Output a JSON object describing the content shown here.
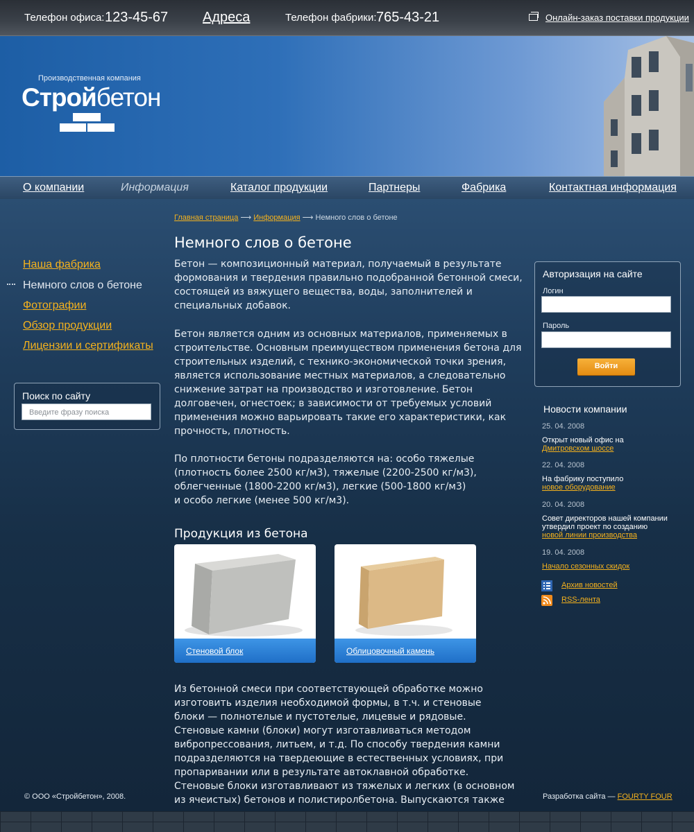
{
  "topbar": {
    "office_label": "Телефон офиса:",
    "office_phone": "123-45-67",
    "addresses": "Адреса",
    "factory_label": "Телефон фабрики:",
    "factory_phone": "765-43-21",
    "order_link": "Онлайн-заказ поставки продукции"
  },
  "header": {
    "company_type": "Производственная компания",
    "logo_bold": "Строй",
    "logo_regular": "бетон"
  },
  "nav": {
    "items": [
      "О компании",
      "Информация",
      "Каталог продукции",
      "Партнеры",
      "Фабрика",
      "Контактная информация"
    ],
    "active": "Информация"
  },
  "sidebar": {
    "items": [
      "Наша фабрика",
      "Немного слов о бетоне",
      "Фотографии",
      "Обзор продукции",
      "Лицензии и сертификаты"
    ],
    "current": "Немного слов о бетоне"
  },
  "search": {
    "title": "Поиск по сайту",
    "placeholder": "Введите фразу поиска"
  },
  "breadcrumbs": {
    "home": "Главная страница",
    "section": "Информация",
    "arrow": "⟶",
    "current": "Немного слов о бетоне"
  },
  "content": {
    "title": "Немного слов о бетоне",
    "p1": [
      "Бетон — композиционный материал, получаемый в результате",
      "формования и твердения правильно подобранной бетонной смеси,",
      "состоящей из вяжущего вещества, воды, заполнителей и",
      "специальных добавок."
    ],
    "p2": [
      "Бетон является одним из основных материалов, применяемых в",
      "строительстве. Основным преимуществом применения бетона для",
      "строительных изделий, с технико-экономической точки зрения,",
      "является использование местных материалов, а следовательно",
      "снижение затрат на производство и изготовление. Бетон",
      "долговечен, огнестоек; в зависимости от требуемых условий",
      "применения можно варьировать такие его характеристики, как",
      "прочность, плотность."
    ],
    "p3": [
      "По плотности бетоны подразделяются на: особо тяжелые",
      "(плотность более 2500 кг/м3), тяжелые (2200-2500 кг/м3),",
      "облегченные (1800-2200 кг/м3), легкие (500-1800 кг/м3)",
      "и особо легкие (менее 500 кг/м3)."
    ],
    "products_title": "Продукция из бетона",
    "products": [
      "Стеновой блок",
      "Облицовочный камень"
    ],
    "p4": [
      "Из бетонной смеси при соответствующей обработке можно",
      "изготовить изделия необходимой формы, в т.ч. и стеновые",
      "блоки — полнотелые и пустотелые, лицевые и рядовые.",
      "Стеновые камни (блоки) могут изготавливаться методом",
      "вибропрессования, литьем, и т.д. По способу твердения камни",
      "подразделяются на твердеющие в естественных условиях, при",
      "пропаривании или в результате автоклавной обработке.",
      "Стеновые блоки изготавливают из тяжелых и легких (в основном",
      "из ячеистых) бетонов и полистиролбетона. Выпускаются также"
    ]
  },
  "login": {
    "title": "Авторизация на сайте",
    "login_label": "Логин",
    "password_label": "Пароль",
    "button": "Войти"
  },
  "news": {
    "title": "Новости компании",
    "items": [
      {
        "date": "25. 04. 2008",
        "text": "Открыт новый офис на",
        "link": "Дмитровском шоссе"
      },
      {
        "date": "22. 04. 2008",
        "text": "На фабрику поступило",
        "link": "новое оборудование"
      },
      {
        "date": "20. 04. 2008",
        "text1": "Совет директоров нашей компании",
        "text2": "утвердил проект по созданию",
        "link": "новой линии производства"
      },
      {
        "date": "19. 04. 2008",
        "link": "Начало сезонных скидок"
      }
    ],
    "archive": "Архив новостей",
    "rss": "RSS-лента"
  },
  "footer": {
    "copyright": "© ООО «Стройбетон», 2008.",
    "dev_label": "Разработка сайта —",
    "dev_link": "FOURTY FOUR"
  },
  "colors": {
    "accent": "#f5b21d",
    "header_blue": "#2e6fb8",
    "button_orange": "#e48c12"
  }
}
